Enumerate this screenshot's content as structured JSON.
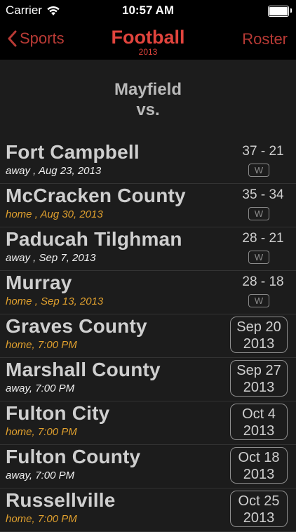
{
  "status": {
    "carrier": "Carrier",
    "time": "10:57 AM"
  },
  "nav": {
    "back_label": "Sports",
    "title": "Football",
    "subtitle": "2013",
    "right_label": "Roster"
  },
  "heading": {
    "line1": "Mayfield",
    "line2": "vs."
  },
  "games": [
    {
      "opponent": "Fort Campbell",
      "details": "away , Aug 23, 2013",
      "location": "away",
      "score": "37 - 21",
      "result": "W"
    },
    {
      "opponent": "McCracken County",
      "details": "home , Aug 30, 2013",
      "location": "home",
      "score": "35 - 34",
      "result": "W"
    },
    {
      "opponent": "Paducah Tilghman",
      "details": "away , Sep 7, 2013",
      "location": "away",
      "score": "28 - 21",
      "result": "W"
    },
    {
      "opponent": "Murray",
      "details": "home , Sep 13, 2013",
      "location": "home",
      "score": "28 - 18",
      "result": "W"
    },
    {
      "opponent": "Graves County",
      "details": "home, 7:00 PM",
      "location": "home",
      "date_line1": "Sep 20",
      "date_line2": "2013"
    },
    {
      "opponent": "Marshall County",
      "details": "away, 7:00 PM",
      "location": "away",
      "date_line1": "Sep 27",
      "date_line2": "2013"
    },
    {
      "opponent": "Fulton City",
      "details": "home, 7:00 PM",
      "location": "home",
      "date_line1": "Oct 4",
      "date_line2": "2013"
    },
    {
      "opponent": "Fulton County",
      "details": "away, 7:00 PM",
      "location": "away",
      "date_line1": "Oct 18",
      "date_line2": "2013"
    },
    {
      "opponent": "Russellville",
      "details": "home, 7:00 PM",
      "location": "home",
      "date_line1": "Oct 25",
      "date_line2": "2013"
    }
  ],
  "colors": {
    "accent": "#e1443d",
    "home": "#e0a02e",
    "away": "#f1f1f1",
    "background": "#1c1c1c"
  }
}
